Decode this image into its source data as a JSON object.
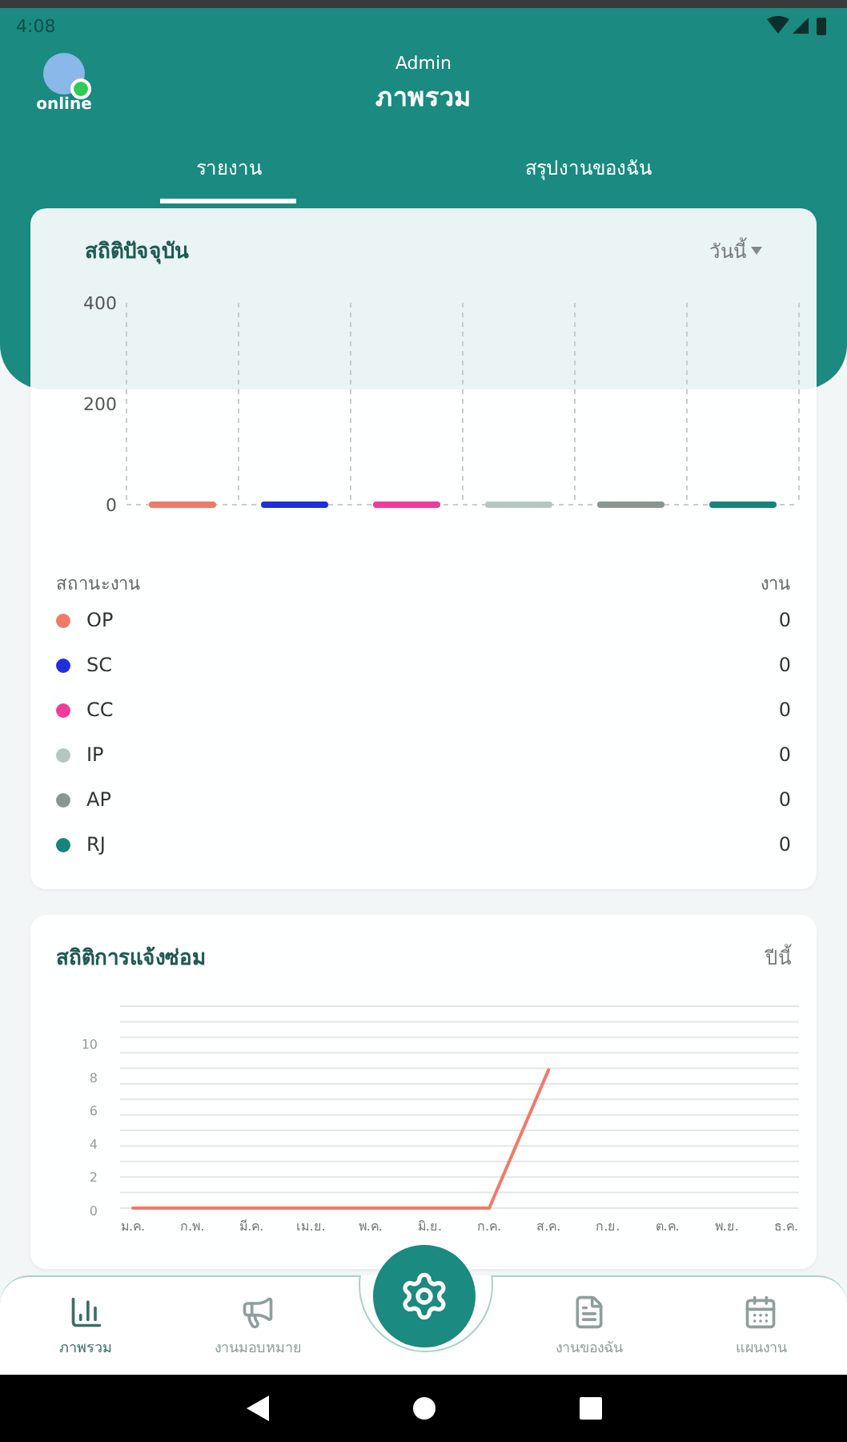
{
  "status_bar": {
    "time": "4:08"
  },
  "header": {
    "user": "Admin",
    "title": "ภาพรวม",
    "presence": "online"
  },
  "tabs": [
    {
      "label": "รายงาน",
      "selected": true
    },
    {
      "label": "สรุปงานของฉัน",
      "selected": false
    }
  ],
  "current_stats": {
    "title": "สถิติปัจจุบัน",
    "period": "วันนี้",
    "chart_data": {
      "type": "bar",
      "ylim": [
        0,
        400
      ],
      "yticks": [
        0,
        200,
        400
      ],
      "series": [
        {
          "color": "#f07a6a",
          "values": [
            0,
            null,
            null,
            null,
            null,
            null
          ]
        },
        {
          "color": "#1f2fe0",
          "values": [
            null,
            0,
            null,
            null,
            null,
            null
          ]
        },
        {
          "color": "#f03c9c",
          "values": [
            null,
            null,
            0,
            null,
            null,
            null
          ]
        },
        {
          "color": "#b4c8c0",
          "values": [
            null,
            null,
            null,
            0,
            null,
            null
          ]
        },
        {
          "color": "#8c9690",
          "values": [
            null,
            null,
            null,
            null,
            0,
            null
          ]
        },
        {
          "color": "#17857a",
          "values": [
            null,
            null,
            null,
            null,
            null,
            0
          ]
        }
      ]
    },
    "status_header": "สถานะงาน",
    "count_header": "งาน",
    "statuses": [
      {
        "label": "OP",
        "count": "0",
        "color": "#f07a6a"
      },
      {
        "label": "SC",
        "count": "0",
        "color": "#1f2fe0"
      },
      {
        "label": "CC",
        "count": "0",
        "color": "#f03c9c"
      },
      {
        "label": "IP",
        "count": "0",
        "color": "#b4c8c0"
      },
      {
        "label": "AP",
        "count": "0",
        "color": "#8c9690"
      },
      {
        "label": "RJ",
        "count": "0",
        "color": "#17857a"
      }
    ]
  },
  "repair_stats": {
    "title": "สถิติการแจ้งซ่อม",
    "period": "ปีนี้",
    "chart_data": {
      "type": "line",
      "categories": [
        "ม.ค.",
        "ก.พ.",
        "มี.ค.",
        "เม.ย.",
        "พ.ค.",
        "มิ.ย.",
        "ก.ค.",
        "ส.ค.",
        "ก.ย.",
        "ต.ค.",
        "พ.ย.",
        "ธ.ค."
      ],
      "ylim": [
        0,
        10
      ],
      "yticks": [
        0,
        2,
        4,
        6,
        8,
        10
      ],
      "grid": true,
      "series": [
        {
          "color": "#f07a6a",
          "values": [
            0,
            0,
            0,
            0,
            0,
            0,
            0,
            8.3,
            null,
            null,
            null,
            null
          ]
        }
      ]
    }
  },
  "bottom_nav": [
    {
      "label": "ภาพรวม",
      "selected": true,
      "kind": "chart"
    },
    {
      "label": "งานมอบหมาย",
      "selected": false,
      "kind": "megaphone"
    },
    {
      "label": "งานของฉัน",
      "selected": false,
      "kind": "document"
    },
    {
      "label": "แผนงาน",
      "selected": false,
      "kind": "calendar"
    }
  ]
}
